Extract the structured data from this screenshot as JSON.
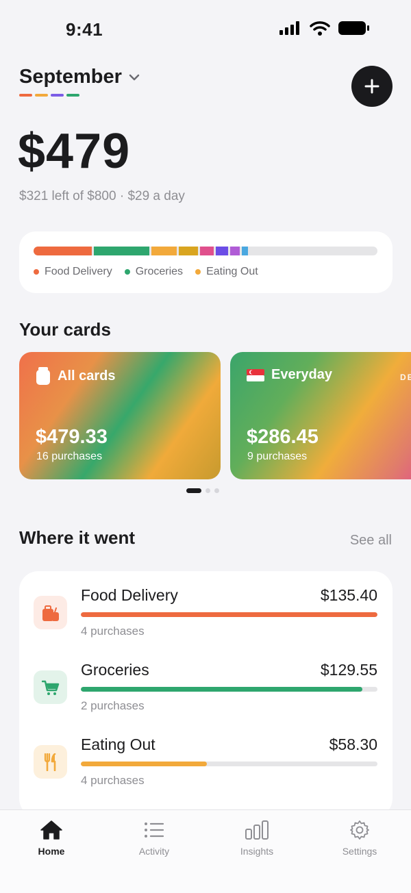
{
  "status": {
    "time": "9:41"
  },
  "header": {
    "month": "September",
    "underline_colors": [
      "#ee6a3f",
      "#f2a93b",
      "#7b5ce6",
      "#2ea66e"
    ]
  },
  "summary": {
    "total": "$479",
    "subtitle": "$321 left of $800 · $29 a day"
  },
  "breakdown": {
    "segments": [
      {
        "color": "#ee6a3f",
        "fraction": 0.169
      },
      {
        "color": "#2ea66e",
        "fraction": 0.162
      },
      {
        "color": "#f2a93b",
        "fraction": 0.073
      },
      {
        "color": "#d9a520",
        "fraction": 0.055
      },
      {
        "color": "#e0508c",
        "fraction": 0.04
      },
      {
        "color": "#6b4de6",
        "fraction": 0.036
      },
      {
        "color": "#b05cd6",
        "fraction": 0.028
      },
      {
        "color": "#4aa8e0",
        "fraction": 0.018
      }
    ],
    "legend": [
      {
        "label": "Food Delivery",
        "color": "#ee6a3f"
      },
      {
        "label": "Groceries",
        "color": "#2ea66e"
      },
      {
        "label": "Eating Out",
        "color": "#f2a93b"
      }
    ]
  },
  "cards": {
    "title": "Your cards",
    "items": [
      {
        "name": "All cards",
        "icon": "wallet-icon",
        "amount": "$479.33",
        "purchases": "16 purchases"
      },
      {
        "name": "Everyday",
        "icon": "singapore-flag-icon",
        "amount": "$286.45",
        "purchases": "9 purchases",
        "tag": "DEBIT"
      }
    ],
    "page_count": 3,
    "active_page": 0
  },
  "categories": {
    "title": "Where it went",
    "see_all": "See all",
    "items": [
      {
        "name": "Food Delivery",
        "amount": "$135.40",
        "purchases": "4 purchases",
        "fraction": 1.0,
        "color": "#ee6a3f",
        "bg": "#fdebe5",
        "icon": "takeout-bag-icon"
      },
      {
        "name": "Groceries",
        "amount": "$129.55",
        "purchases": "2 purchases",
        "fraction": 0.95,
        "color": "#2ea66e",
        "bg": "#e3f3ea",
        "icon": "shopping-cart-icon"
      },
      {
        "name": "Eating Out",
        "amount": "$58.30",
        "purchases": "4 purchases",
        "fraction": 0.425,
        "color": "#f2a93b",
        "bg": "#fdf0dc",
        "icon": "fork-knife-icon"
      }
    ]
  },
  "tabbar": {
    "tabs": [
      {
        "label": "Home",
        "icon": "home-icon",
        "active": true
      },
      {
        "label": "Activity",
        "icon": "list-icon",
        "active": false
      },
      {
        "label": "Insights",
        "icon": "bar-chart-icon",
        "active": false
      },
      {
        "label": "Settings",
        "icon": "gear-icon",
        "active": false
      }
    ]
  }
}
